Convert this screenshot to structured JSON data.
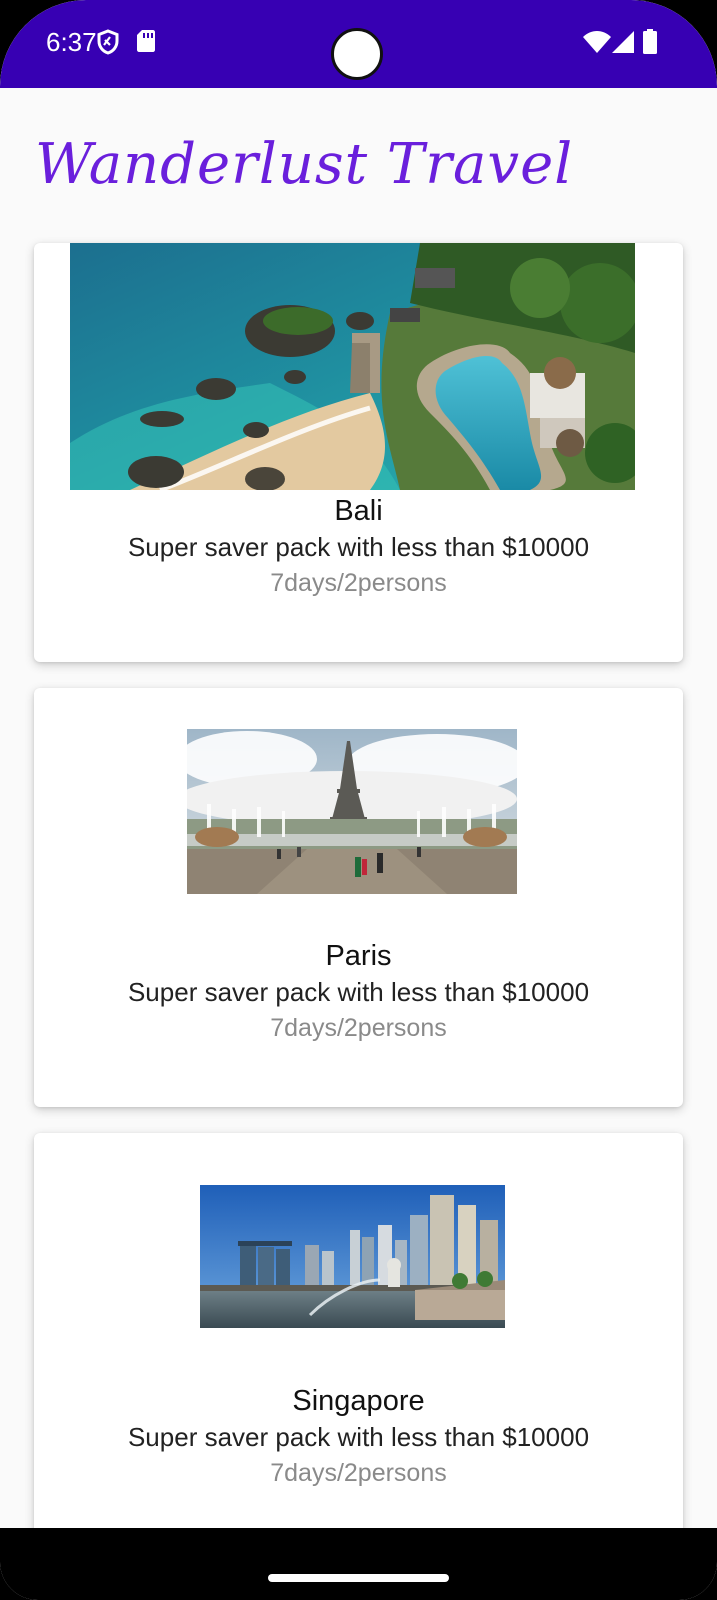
{
  "status_bar": {
    "time": "6:37",
    "color": "#3700b3",
    "icons_left": [
      "shield-icon",
      "sd-card-icon"
    ],
    "icons_right": [
      "wifi-icon",
      "cellular-signal-icon",
      "battery-icon"
    ]
  },
  "app": {
    "title": "Wanderlust Travel",
    "title_color": "#6a1fdc"
  },
  "destinations": [
    {
      "name": "Bali",
      "description": "Super saver pack with less than $10000",
      "duration": "7days/2persons",
      "image": "bali-beach-resort-photo"
    },
    {
      "name": "Paris",
      "description": "Super saver pack with less than $10000",
      "duration": "7days/2persons",
      "image": "paris-eiffel-tower-photo"
    },
    {
      "name": "Singapore",
      "description": "Super saver pack with less than $10000",
      "duration": "7days/2persons",
      "image": "singapore-marina-bay-skyline-photo"
    }
  ]
}
